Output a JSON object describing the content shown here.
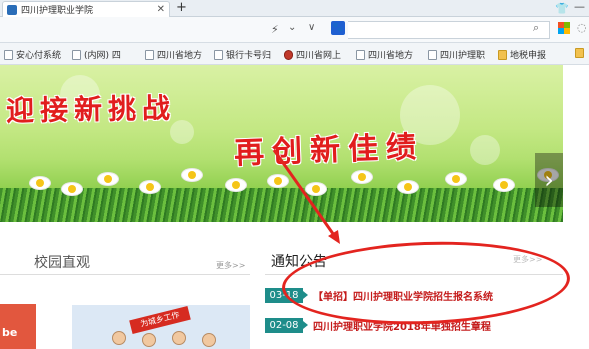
{
  "browser": {
    "tab_title": "四川护理职业学院",
    "new_tab": "+",
    "close": "✕"
  },
  "bookmarks": [
    "安心付系统",
    "(内网) 四",
    "四川省地方",
    "银行卡号归",
    "四川省网上",
    "四川省地方",
    "四川护理职",
    "地税申报"
  ],
  "banner": {
    "slogan_line1": "迎接新挑战",
    "slogan_line2": "再创新佳绩",
    "next_arrow": "›"
  },
  "campus": {
    "title": "校园直观",
    "more": "更多>>",
    "thumb_text": "be",
    "pic_flag": "为城乡工作"
  },
  "notice": {
    "title": "通知公告",
    "more": "更多>>",
    "items": [
      {
        "date": "03-18",
        "text": "【单招】四川护理职业学院招生报名系统"
      },
      {
        "date": "02-08",
        "text": "四川护理职业学院2018年单独招生章程"
      }
    ]
  },
  "colors": {
    "annotation_red": "#e3241f",
    "badge_teal": "#1e8d8a",
    "link_red": "#c41a1a"
  }
}
